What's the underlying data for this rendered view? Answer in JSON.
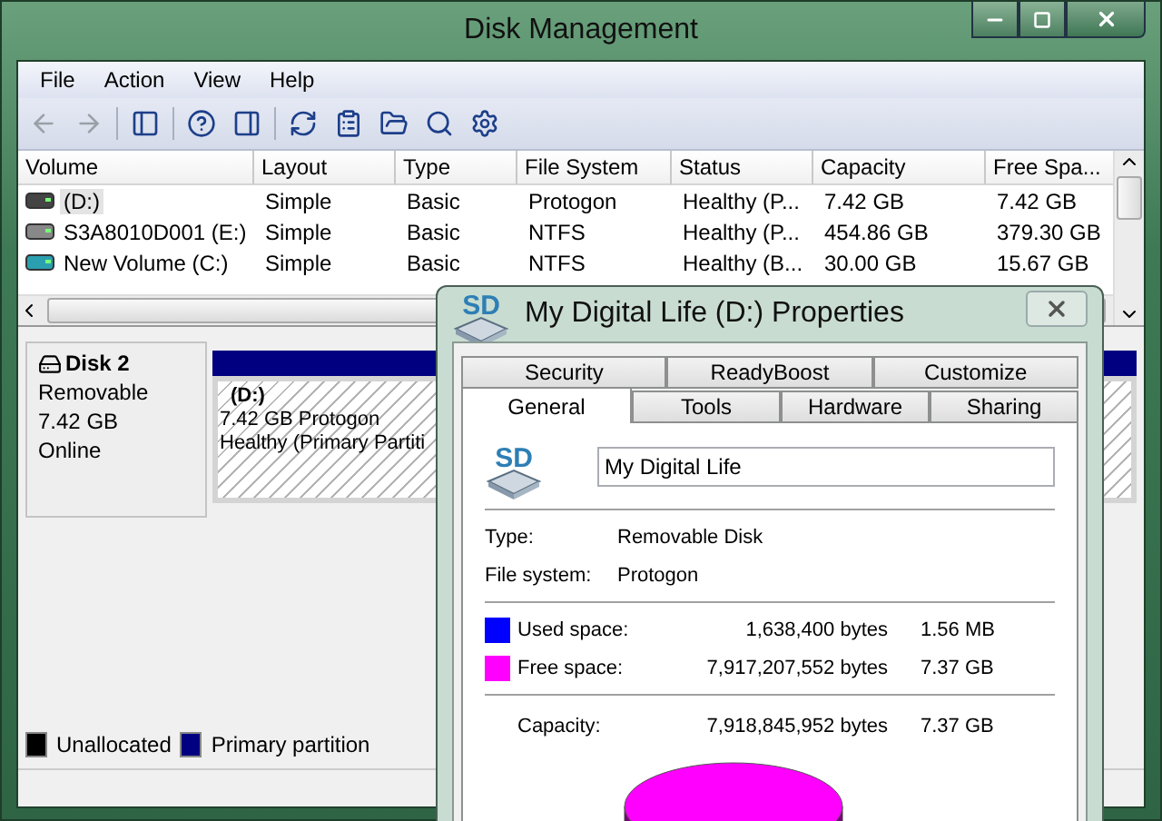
{
  "window": {
    "title": "Disk Management"
  },
  "menu": [
    "File",
    "Action",
    "View",
    "Help"
  ],
  "toolbar": [
    {
      "kind": "back",
      "disabled": true
    },
    {
      "kind": "forward",
      "disabled": true
    },
    {
      "kind": "panel-left",
      "disabled": false
    },
    {
      "kind": "help",
      "disabled": false
    },
    {
      "kind": "panel-right",
      "disabled": false
    },
    {
      "kind": "refresh",
      "disabled": false
    },
    {
      "kind": "properties",
      "disabled": false
    },
    {
      "kind": "folder",
      "disabled": false
    },
    {
      "kind": "zoom",
      "disabled": false
    },
    {
      "kind": "settings",
      "disabled": false
    }
  ],
  "volumes": {
    "columns": [
      "Volume",
      "Layout",
      "Type",
      "File System",
      "Status",
      "Capacity",
      "Free Spa..."
    ],
    "rows": [
      {
        "kind": "removable",
        "selected": true,
        "cells": [
          "(D:)",
          "Simple",
          "Basic",
          "Protogon",
          "Healthy (P...",
          "7.42 GB",
          "7.42 GB"
        ]
      },
      {
        "kind": "disk",
        "selected": false,
        "cells": [
          "S3A8010D001 (E:)",
          "Simple",
          "Basic",
          "NTFS",
          "Healthy (P...",
          "454.86 GB",
          "379.30 GB"
        ]
      },
      {
        "kind": "system",
        "selected": false,
        "cells": [
          "New Volume (C:)",
          "Simple",
          "Basic",
          "NTFS",
          "Healthy (B...",
          "30.00 GB",
          "15.67 GB"
        ]
      }
    ]
  },
  "disks": [
    {
      "name": "Disk 2",
      "type": "Removable",
      "size": "7.42 GB",
      "status": "Online",
      "partitions": [
        {
          "label": "(D:)",
          "size": "7.42 GB Protogon",
          "status": "Healthy (Primary Partiti",
          "color": "#000080"
        }
      ]
    }
  ],
  "legend": [
    {
      "label": "Unallocated",
      "color": "#000000"
    },
    {
      "label": "Primary partition",
      "color": "#000080"
    }
  ],
  "dialog": {
    "title": "My Digital Life (D:) Properties",
    "title_icon_text": "SD",
    "icon_text": "SD",
    "tab_rows": [
      [
        {
          "label": "Security",
          "selected": false
        },
        {
          "label": "ReadyBoost",
          "selected": false
        },
        {
          "label": "Customize",
          "selected": false
        }
      ],
      [
        {
          "label": "General",
          "selected": true
        },
        {
          "label": "Tools",
          "selected": false
        },
        {
          "label": "Hardware",
          "selected": false
        },
        {
          "label": "Sharing",
          "selected": false
        }
      ]
    ],
    "name_field": {
      "value": "My Digital Life"
    },
    "info": [
      {
        "label": "Type:",
        "value": "Removable Disk"
      },
      {
        "label": "File system:",
        "value": "Protogon"
      }
    ],
    "space": [
      {
        "label": "Used space:",
        "bytes": "1,638,400 bytes",
        "size": "1.56 MB",
        "color": "#0000ff"
      },
      {
        "label": "Free space:",
        "bytes": "7,917,207,552 bytes",
        "size": "7.37 GB",
        "color": "#ff00ff"
      }
    ],
    "capacity": {
      "label": "Capacity:",
      "bytes": "7,918,845,952 bytes",
      "size": "7.37 GB"
    }
  }
}
